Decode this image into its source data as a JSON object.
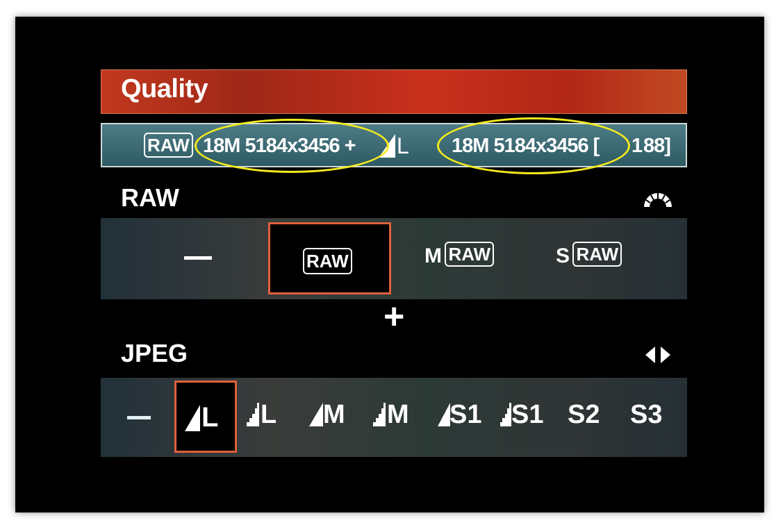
{
  "header": {
    "title": "Quality"
  },
  "info": {
    "raw_badge": "RAW",
    "raw_size": "18M 5184x3456 +",
    "jpeg_badge": "L",
    "jpeg_size": "18M 5184x3456 [",
    "shots": "1",
    "shots_tail": "88]"
  },
  "raw_section": {
    "label": "RAW",
    "icon": "main-dial-icon",
    "options": [
      {
        "label": "—",
        "selected": false
      },
      {
        "label": "RAW",
        "selected": true
      },
      {
        "prefix": "M",
        "label": "RAW",
        "selected": false
      },
      {
        "prefix": "S",
        "label": "RAW",
        "selected": false
      }
    ]
  },
  "plus_sign": "+",
  "jpeg_section": {
    "label": "JPEG",
    "icon": "left-right-arrows-icon",
    "options": [
      {
        "label": "—"
      },
      {
        "label": "L",
        "quality": "fine",
        "selected": true
      },
      {
        "label": "L",
        "quality": "normal"
      },
      {
        "label": "M",
        "quality": "fine"
      },
      {
        "label": "M",
        "quality": "normal"
      },
      {
        "label": "S1",
        "quality": "fine"
      },
      {
        "label": "S1",
        "quality": "normal"
      },
      {
        "label": "S2"
      },
      {
        "label": "S3"
      }
    ]
  },
  "colors": {
    "selection": "#e0603c",
    "highlight_ellipse": "#f4ea1e",
    "title_bar": "#b8301c",
    "info_bar": "#3d6b74"
  }
}
